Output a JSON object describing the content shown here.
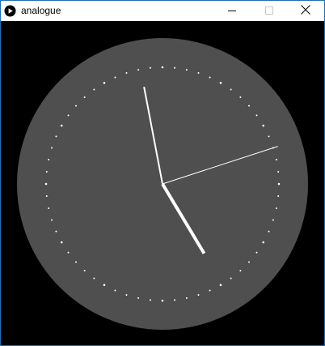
{
  "window": {
    "title": "analogue",
    "app_icon": "play-circle-icon",
    "controls": {
      "minimize_icon": "minimize-icon",
      "maximize_icon": "maximize-icon",
      "close_icon": "close-icon"
    }
  },
  "clock": {
    "face_color": "#4f4f4f",
    "background_color": "#000000",
    "marker_color": "#ffffff",
    "hand_color": "#ffffff",
    "marker_count": 60,
    "time": {
      "hours": 4,
      "minutes": 58,
      "seconds": 12
    }
  }
}
